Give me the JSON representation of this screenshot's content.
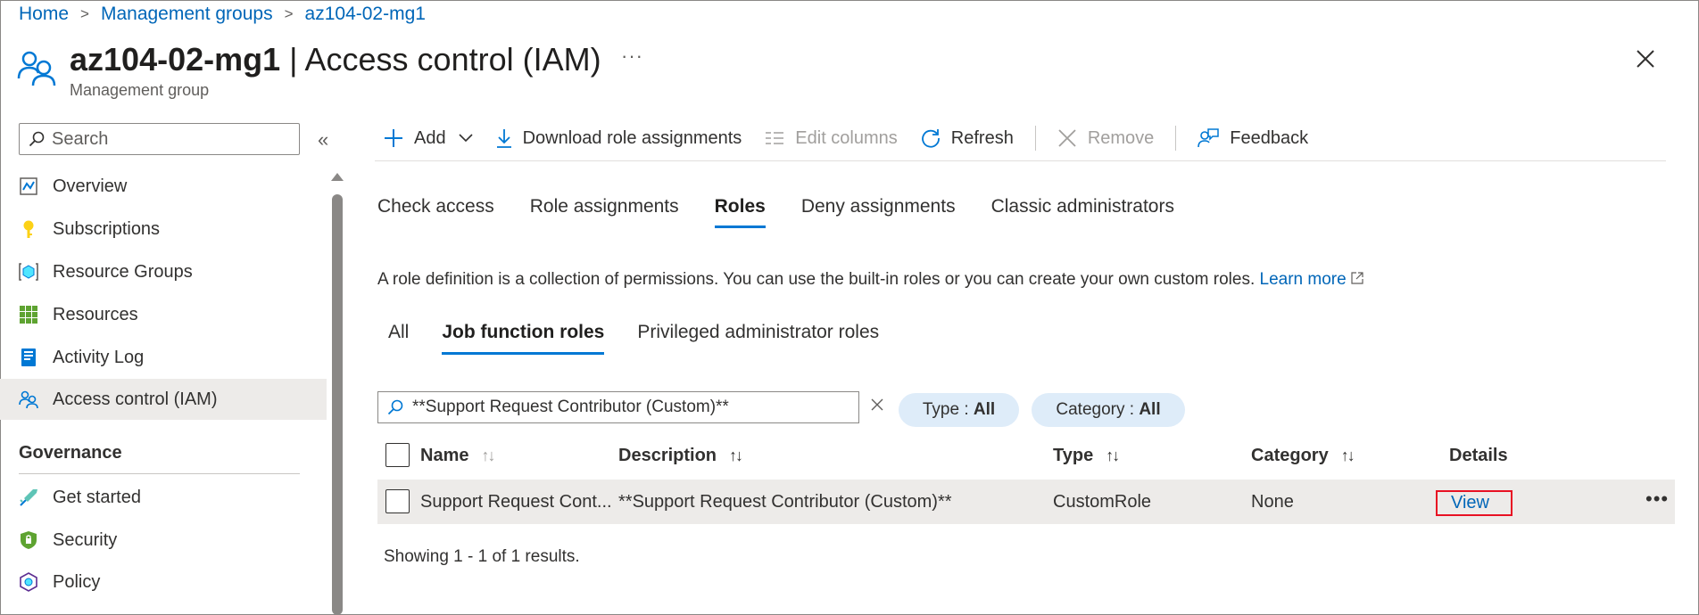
{
  "breadcrumb": {
    "home": "Home",
    "management_groups": "Management groups",
    "current": "az104-02-mg1"
  },
  "header": {
    "name": "az104-02-mg1",
    "section": "| Access control (IAM)",
    "subtitle": "Management group",
    "more": "···"
  },
  "sidebar": {
    "search_placeholder": "Search",
    "collapse": "«",
    "items": [
      {
        "label": "Overview",
        "icon": "overview-icon"
      },
      {
        "label": "Subscriptions",
        "icon": "key-icon"
      },
      {
        "label": "Resource Groups",
        "icon": "resource-group-icon"
      },
      {
        "label": "Resources",
        "icon": "grid-icon"
      },
      {
        "label": "Activity Log",
        "icon": "log-icon"
      },
      {
        "label": "Access control (IAM)",
        "icon": "people-icon",
        "active": true
      }
    ],
    "section_governance": "Governance",
    "governance_items": [
      {
        "label": "Get started",
        "icon": "quickstart-icon"
      },
      {
        "label": "Security",
        "icon": "shield-icon"
      },
      {
        "label": "Policy",
        "icon": "policy-icon"
      }
    ]
  },
  "toolbar": {
    "add": "Add",
    "download": "Download role assignments",
    "edit_columns": "Edit columns",
    "refresh": "Refresh",
    "remove": "Remove",
    "feedback": "Feedback"
  },
  "tabs": [
    "Check access",
    "Role assignments",
    "Roles",
    "Deny assignments",
    "Classic administrators"
  ],
  "active_tab": "Roles",
  "description": {
    "text": "A role definition is a collection of permissions. You can use the built-in roles or you can create your own custom roles.",
    "link": "Learn more"
  },
  "subtabs": [
    "All",
    "Job function roles",
    "Privileged administrator roles"
  ],
  "active_subtab": "Job function roles",
  "filter": {
    "search_value": "**Support Request Contributor (Custom)**",
    "type_label": "Type : ",
    "type_value": "All",
    "category_label": "Category : ",
    "category_value": "All"
  },
  "table": {
    "columns": {
      "name": "Name",
      "description": "Description",
      "type": "Type",
      "category": "Category",
      "details": "Details"
    },
    "sort_glyph": "↑↓",
    "rows": [
      {
        "name": "Support Request Cont...",
        "description": "**Support Request Contributor (Custom)**",
        "type": "CustomRole",
        "category": "None",
        "details": "View",
        "more": "•••"
      }
    ],
    "results_text": "Showing 1 - 1 of 1 results."
  },
  "colors": {
    "accent": "#0078d4",
    "link": "#0066b8",
    "highlight_border": "#e81123",
    "pill_bg": "#deecf9",
    "row_bg": "#edebe9"
  }
}
